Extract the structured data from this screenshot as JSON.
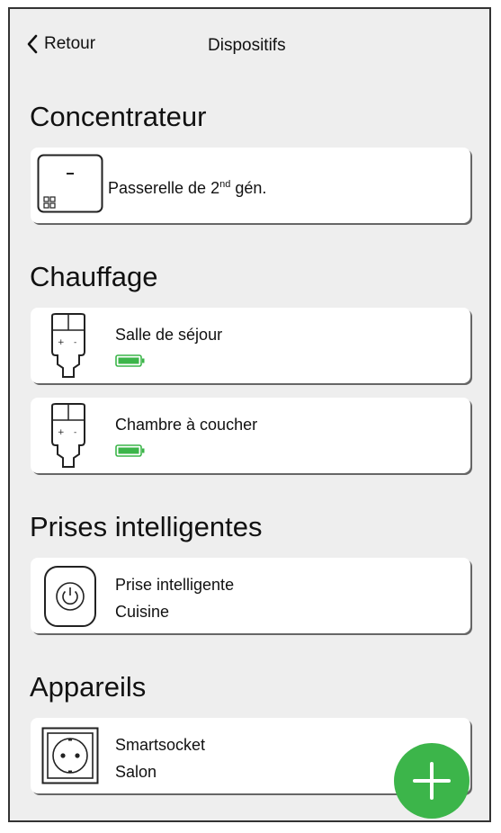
{
  "header": {
    "back_label": "Retour",
    "title": "Dispositifs"
  },
  "sections": {
    "hub": {
      "title": "Concentrateur",
      "device_label": "Passerelle de 2",
      "device_sup": "nd",
      "device_suffix": " gén.",
      "icon_dash": "-"
    },
    "heating": {
      "title": "Chauffage",
      "devices": [
        {
          "name": "Salle de séjour",
          "battery_icon": "battery-full-icon"
        },
        {
          "name": "Chambre à coucher",
          "battery_icon": "battery-full-icon"
        }
      ]
    },
    "plugs": {
      "title": "Prises intelligentes",
      "device_name": "Prise intelligente",
      "device_room": "Cuisine"
    },
    "appliances": {
      "title": "Appareils",
      "device_name": "Smartsocket",
      "device_room": "Salon"
    }
  },
  "colors": {
    "accent_green": "#3cb54a",
    "background": "#eeeeee",
    "card": "#ffffff"
  }
}
